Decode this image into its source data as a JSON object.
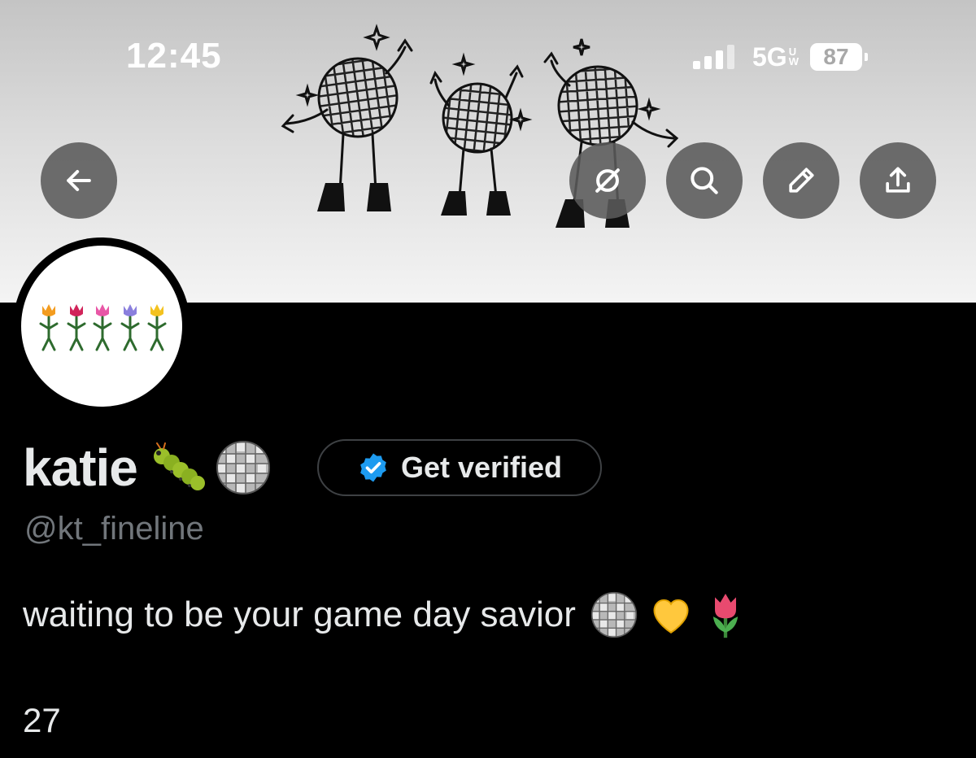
{
  "status_bar": {
    "time": "12:45",
    "network": "5G",
    "network_suffix_top": "U",
    "network_suffix_bottom": "W",
    "battery": "87"
  },
  "header": {
    "back_icon": "arrow-left-icon",
    "actions": [
      "grok-icon",
      "search-icon",
      "edit-icon",
      "share-icon"
    ]
  },
  "profile": {
    "display_name": "katie",
    "name_emojis": [
      "caterpillar-emoji",
      "disco-ball-emoji"
    ],
    "get_verified_label": "Get verified",
    "handle": "@kt_fineline",
    "bio": "waiting to be your game day savior",
    "bio_emojis": [
      "disco-ball-emoji",
      "yellow-heart-emoji",
      "tulip-emoji"
    ],
    "count": "27"
  },
  "colors": {
    "background": "#000000",
    "text_primary": "#e7e9ea",
    "text_secondary": "#71767b",
    "verified_blue": "#1d9bf0",
    "button_border": "#3e4144"
  }
}
